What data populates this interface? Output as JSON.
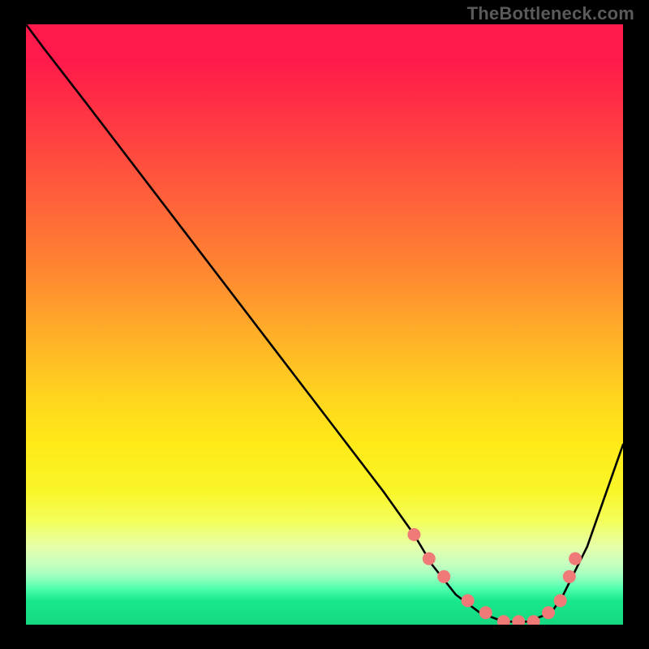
{
  "watermark": "TheBottleneck.com",
  "chart_data": {
    "type": "line",
    "title": "",
    "xlabel": "",
    "ylabel": "",
    "ylim": [
      0,
      100
    ],
    "series": [
      {
        "name": "curve",
        "x": [
          0.0,
          0.03,
          0.1,
          0.2,
          0.3,
          0.4,
          0.5,
          0.6,
          0.65,
          0.68,
          0.72,
          0.76,
          0.8,
          0.84,
          0.88,
          0.9,
          0.94,
          1.0
        ],
        "values": [
          100,
          96,
          87,
          74,
          61,
          48,
          35,
          22,
          15,
          10,
          5,
          2,
          0.5,
          0.5,
          2,
          5,
          13,
          30
        ]
      }
    ],
    "markers": {
      "x": [
        0.65,
        0.675,
        0.7,
        0.74,
        0.77,
        0.8,
        0.825,
        0.85,
        0.875,
        0.895,
        0.91,
        0.92
      ],
      "values": [
        15,
        11,
        8,
        4,
        2,
        0.5,
        0.5,
        0.5,
        2,
        4,
        8,
        11
      ]
    },
    "marker_color": "#ef7a78",
    "curve_color": "#000000"
  },
  "layout": {
    "frame_color": "#000000"
  }
}
